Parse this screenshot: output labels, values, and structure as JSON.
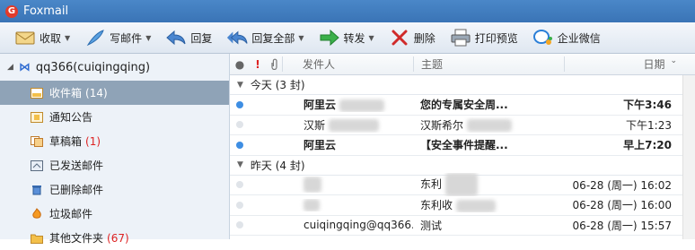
{
  "app": {
    "title": "Foxmail"
  },
  "toolbar": {
    "receive": "收取",
    "compose": "写邮件",
    "reply": "回复",
    "reply_all": "回复全部",
    "forward": "转发",
    "delete": "删除",
    "print_preview": "打印预览",
    "enterprise_wechat": "企业微信"
  },
  "sidebar": {
    "account": "qq366(cuiqingqing)",
    "folders": [
      {
        "label": "收件箱",
        "count": "(14)"
      },
      {
        "label": "通知公告",
        "count": ""
      },
      {
        "label": "草稿箱",
        "count": "(1)"
      },
      {
        "label": "已发送邮件",
        "count": ""
      },
      {
        "label": "已删除邮件",
        "count": ""
      },
      {
        "label": "垃圾邮件",
        "count": ""
      },
      {
        "label": "其他文件夹",
        "count": "(67)"
      }
    ]
  },
  "list": {
    "headers": {
      "from": "发件人",
      "subject": "主题",
      "date": "日期"
    },
    "groups": [
      {
        "label": "今天 (3 封)",
        "rows": [
          {
            "from": "阿里云",
            "subject": "您的专属安全周...",
            "date": "下午3:46",
            "unread": true
          },
          {
            "from": "汉斯",
            "subject": "汉斯希尔",
            "date": "下午1:23",
            "unread": false
          },
          {
            "from": "阿里云",
            "subject": "【安全事件提醒...",
            "date": "早上7:20",
            "unread": true
          }
        ]
      },
      {
        "label": "昨天 (4 封)",
        "rows": [
          {
            "from": "",
            "subject": "东利",
            "date": "06-28 (周一) 16:02",
            "unread": false
          },
          {
            "from": "",
            "subject": "东利收",
            "date": "06-28 (周一) 16:00",
            "unread": false
          },
          {
            "from": "cuiqingqing@qq366....",
            "subject": "测试",
            "date": "06-28 (周一) 15:57",
            "unread": false
          }
        ]
      }
    ]
  }
}
